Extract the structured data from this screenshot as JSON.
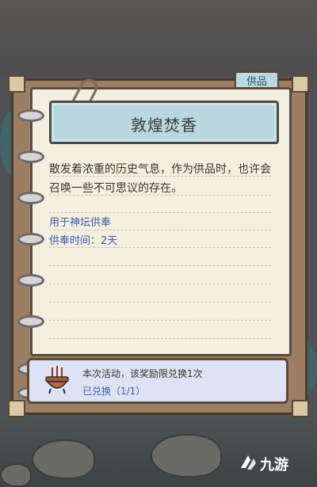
{
  "tab": {
    "label": "供品"
  },
  "item": {
    "title": "敦煌焚香",
    "description": "散发着浓重的历史气息，作为供品时，也许会召唤一些不可思议的存在。",
    "usage": "用于神坛供奉",
    "duration": "供奉时间：2天"
  },
  "redeem": {
    "note": "本次活动，该奖励限兑换1次",
    "status": "已兑换（1/1）"
  },
  "watermark": {
    "text": "九游"
  },
  "colors": {
    "accent_text": "#3d5da6",
    "title_plate": "#b7d8de",
    "paper": "#f5efe1"
  }
}
